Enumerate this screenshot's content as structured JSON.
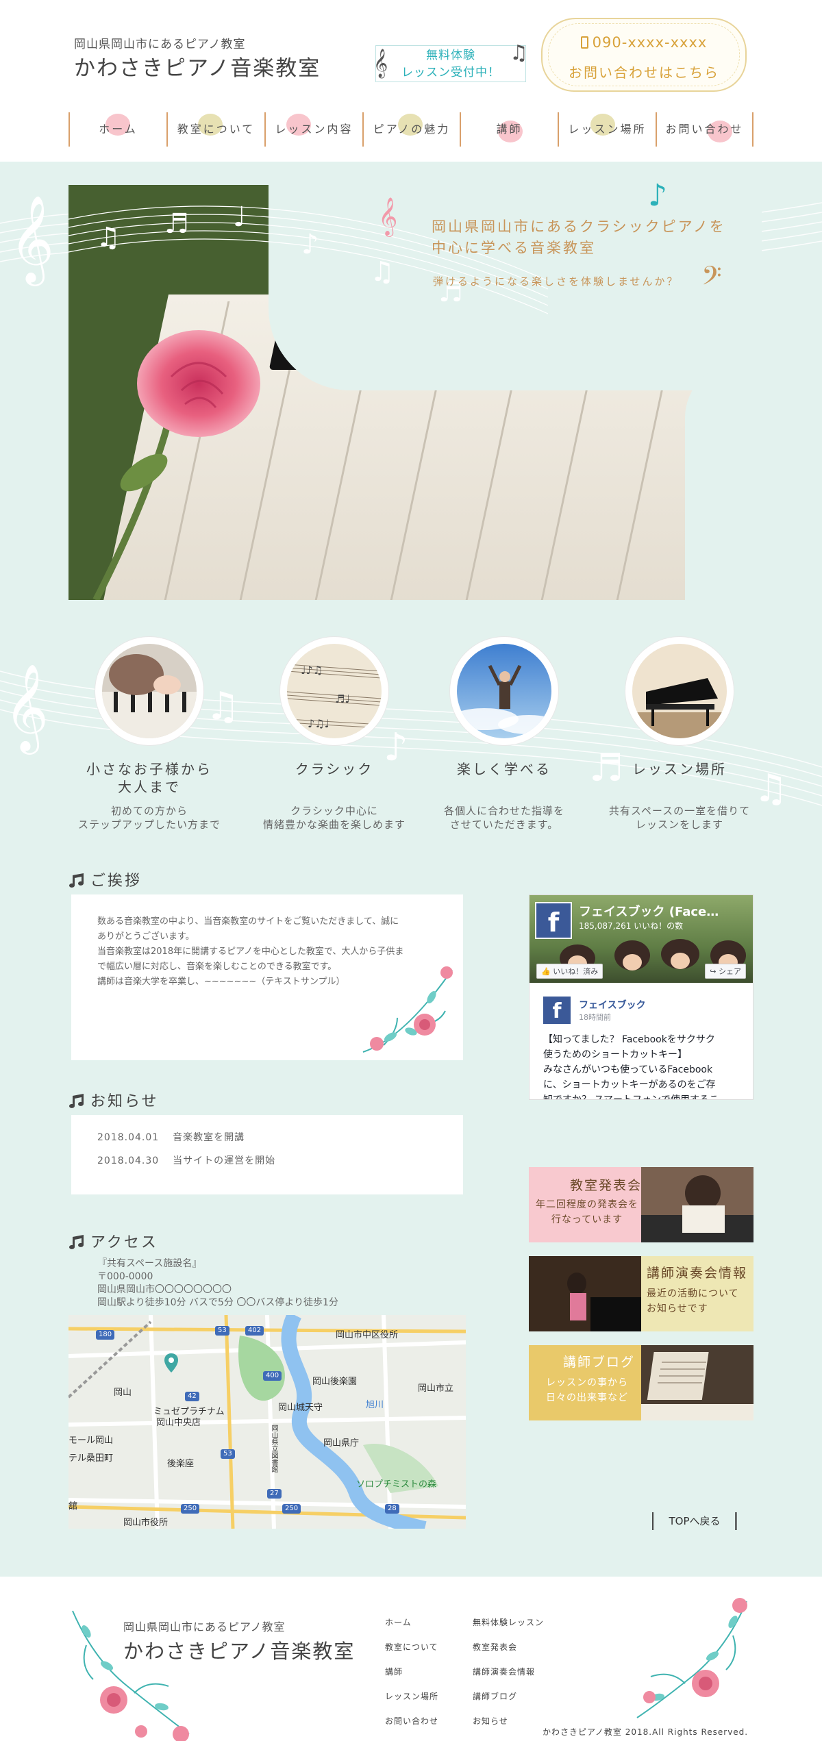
{
  "header": {
    "subtitle": "岡山県岡山市にあるピアノ教室",
    "title": "かわさきピアノ音楽教室",
    "trial_line1": "無料体験",
    "trial_line2": "レッスン受付中！",
    "phone": "090-xxxx-xxxx",
    "contact_label": "お問い合わせはこちら"
  },
  "nav": [
    {
      "label": "ホーム",
      "dot": "#f8c5cc"
    },
    {
      "label": "教室について",
      "dot": "#e7e1b3"
    },
    {
      "label": "レッスン内容",
      "dot": "#f8c5cc"
    },
    {
      "label": "ピアノの魅力",
      "dot": "#e7e1b3"
    },
    {
      "label": "講師",
      "dot": "#f8c5cc"
    },
    {
      "label": "レッスン場所",
      "dot": "#e7e1b3"
    },
    {
      "label": "お問い合わせ",
      "dot": "#f8c5cc"
    }
  ],
  "hero": {
    "title_line1": "岡山県岡山市にあるクラシックピアノを",
    "title_line2": "中心に学べる音楽教室",
    "subtitle": "弾けるようになる楽しさを体験しませんか？"
  },
  "features": [
    {
      "title_line1": "小さなお子様から",
      "title_line2": "大人まで",
      "desc_line1": "初めての方から",
      "desc_line2": "ステップアップしたい方まで"
    },
    {
      "title_line1": "クラシック",
      "title_line2": "",
      "desc_line1": "クラシック中心に",
      "desc_line2": "情緒豊かな楽曲を楽しめます"
    },
    {
      "title_line1": "楽しく学べる",
      "title_line2": "",
      "desc_line1": "各個人に合わせた指導を",
      "desc_line2": "させていただきます。"
    },
    {
      "title_line1": "レッスン場所",
      "title_line2": "",
      "desc_line1": "共有スペースの一室を借りて",
      "desc_line2": "レッスンをします"
    }
  ],
  "greeting": {
    "heading": "ご挨拶",
    "lines": [
      "数ある音楽教室の中より、当音楽教室のサイトをご覧いただきまして、誠に",
      "ありがとうございます。",
      "当音楽教室は2018年に開講するピアノを中心とした教室で、大人から子供ま",
      "で幅広い層に対応し、音楽を楽しむことのできる教室です。",
      "講師は音楽大学を卒業し、~~~~~~~（テキストサンプル）"
    ]
  },
  "news": {
    "heading": "お知らせ",
    "items": [
      {
        "date": "2018.04.01",
        "text": "音楽教室を開講"
      },
      {
        "date": "2018.04.30",
        "text": "当サイトの運営を開始"
      }
    ]
  },
  "access": {
    "heading": "アクセス",
    "lines": [
      "『共有スペース施設名』",
      "〒000-0000",
      "岡山県岡山市〇〇〇〇〇〇〇〇",
      "岡山駅より徒歩10分 バスで5分 〇〇バス停より徒歩1分"
    ],
    "map_labels": [
      "岡山市中区役所",
      "岡山後楽園",
      "岡山市立",
      "岡山城天守",
      "ミュゼプラチナム",
      "岡山中央店",
      "岡山県庁",
      "後楽座",
      "岡山",
      "ソロプチミストの森",
      "岡山市役所",
      "テル桑田町",
      "モール岡山",
      "旭川",
      "岡山県立図書館",
      "舘"
    ],
    "map_routes": [
      "180",
      "53",
      "402",
      "400",
      "42",
      "53",
      "27",
      "250",
      "250",
      "28"
    ]
  },
  "facebook": {
    "page_name": "フェイスブック (Face…",
    "likes": "185,087,261 いいね！の数",
    "like_button": "いいね！済み",
    "share_button": "シェア",
    "post_name": "フェイスブック",
    "post_time": "18時間前",
    "post_lines": [
      "【知ってました？ Facebookをサクサク",
      "使うためのショートカットキー】",
      "みなさんがいつも使っているFacebook",
      "に、ショートカットキーがあるのをご存",
      "知ですか？ スマートフォンで使用するこ"
    ]
  },
  "banners": [
    {
      "title": "教室発表会",
      "desc_line1": "年二回程度の発表会を",
      "desc_line2": "行なっています",
      "bg": "#f8c9cf",
      "color": "#6b4a2a"
    },
    {
      "title": "講師演奏会情報",
      "desc_line1": "最近の活動について",
      "desc_line2": "お知らせです",
      "bg": "#eee7b4",
      "color": "#6b4a2a"
    },
    {
      "title": "講師ブログ",
      "desc_line1": "レッスンの事から",
      "desc_line2": "日々の出来事など",
      "bg": "#e9c96a",
      "color": "#ffffff"
    }
  ],
  "to_top": "TOPへ戻る",
  "footer": {
    "subtitle": "岡山県岡山市にあるピアノ教室",
    "title": "かわさきピアノ音楽教室",
    "links_col1": [
      "ホーム",
      "教室について",
      "講師",
      "レッスン場所",
      "お問い合わせ"
    ],
    "links_col2": [
      "無料体験レッスン",
      "教室発表会",
      "講師演奏会情報",
      "講師ブログ",
      "お知らせ"
    ],
    "copyright": "かわさきピアノ教室 2018.All Rights Reserved."
  },
  "colors": {
    "mint_bg": "#e3f2ee",
    "gold": "#c8955a",
    "accent_teal": "#2cb1b9",
    "nav_border": "#d9a06b"
  }
}
